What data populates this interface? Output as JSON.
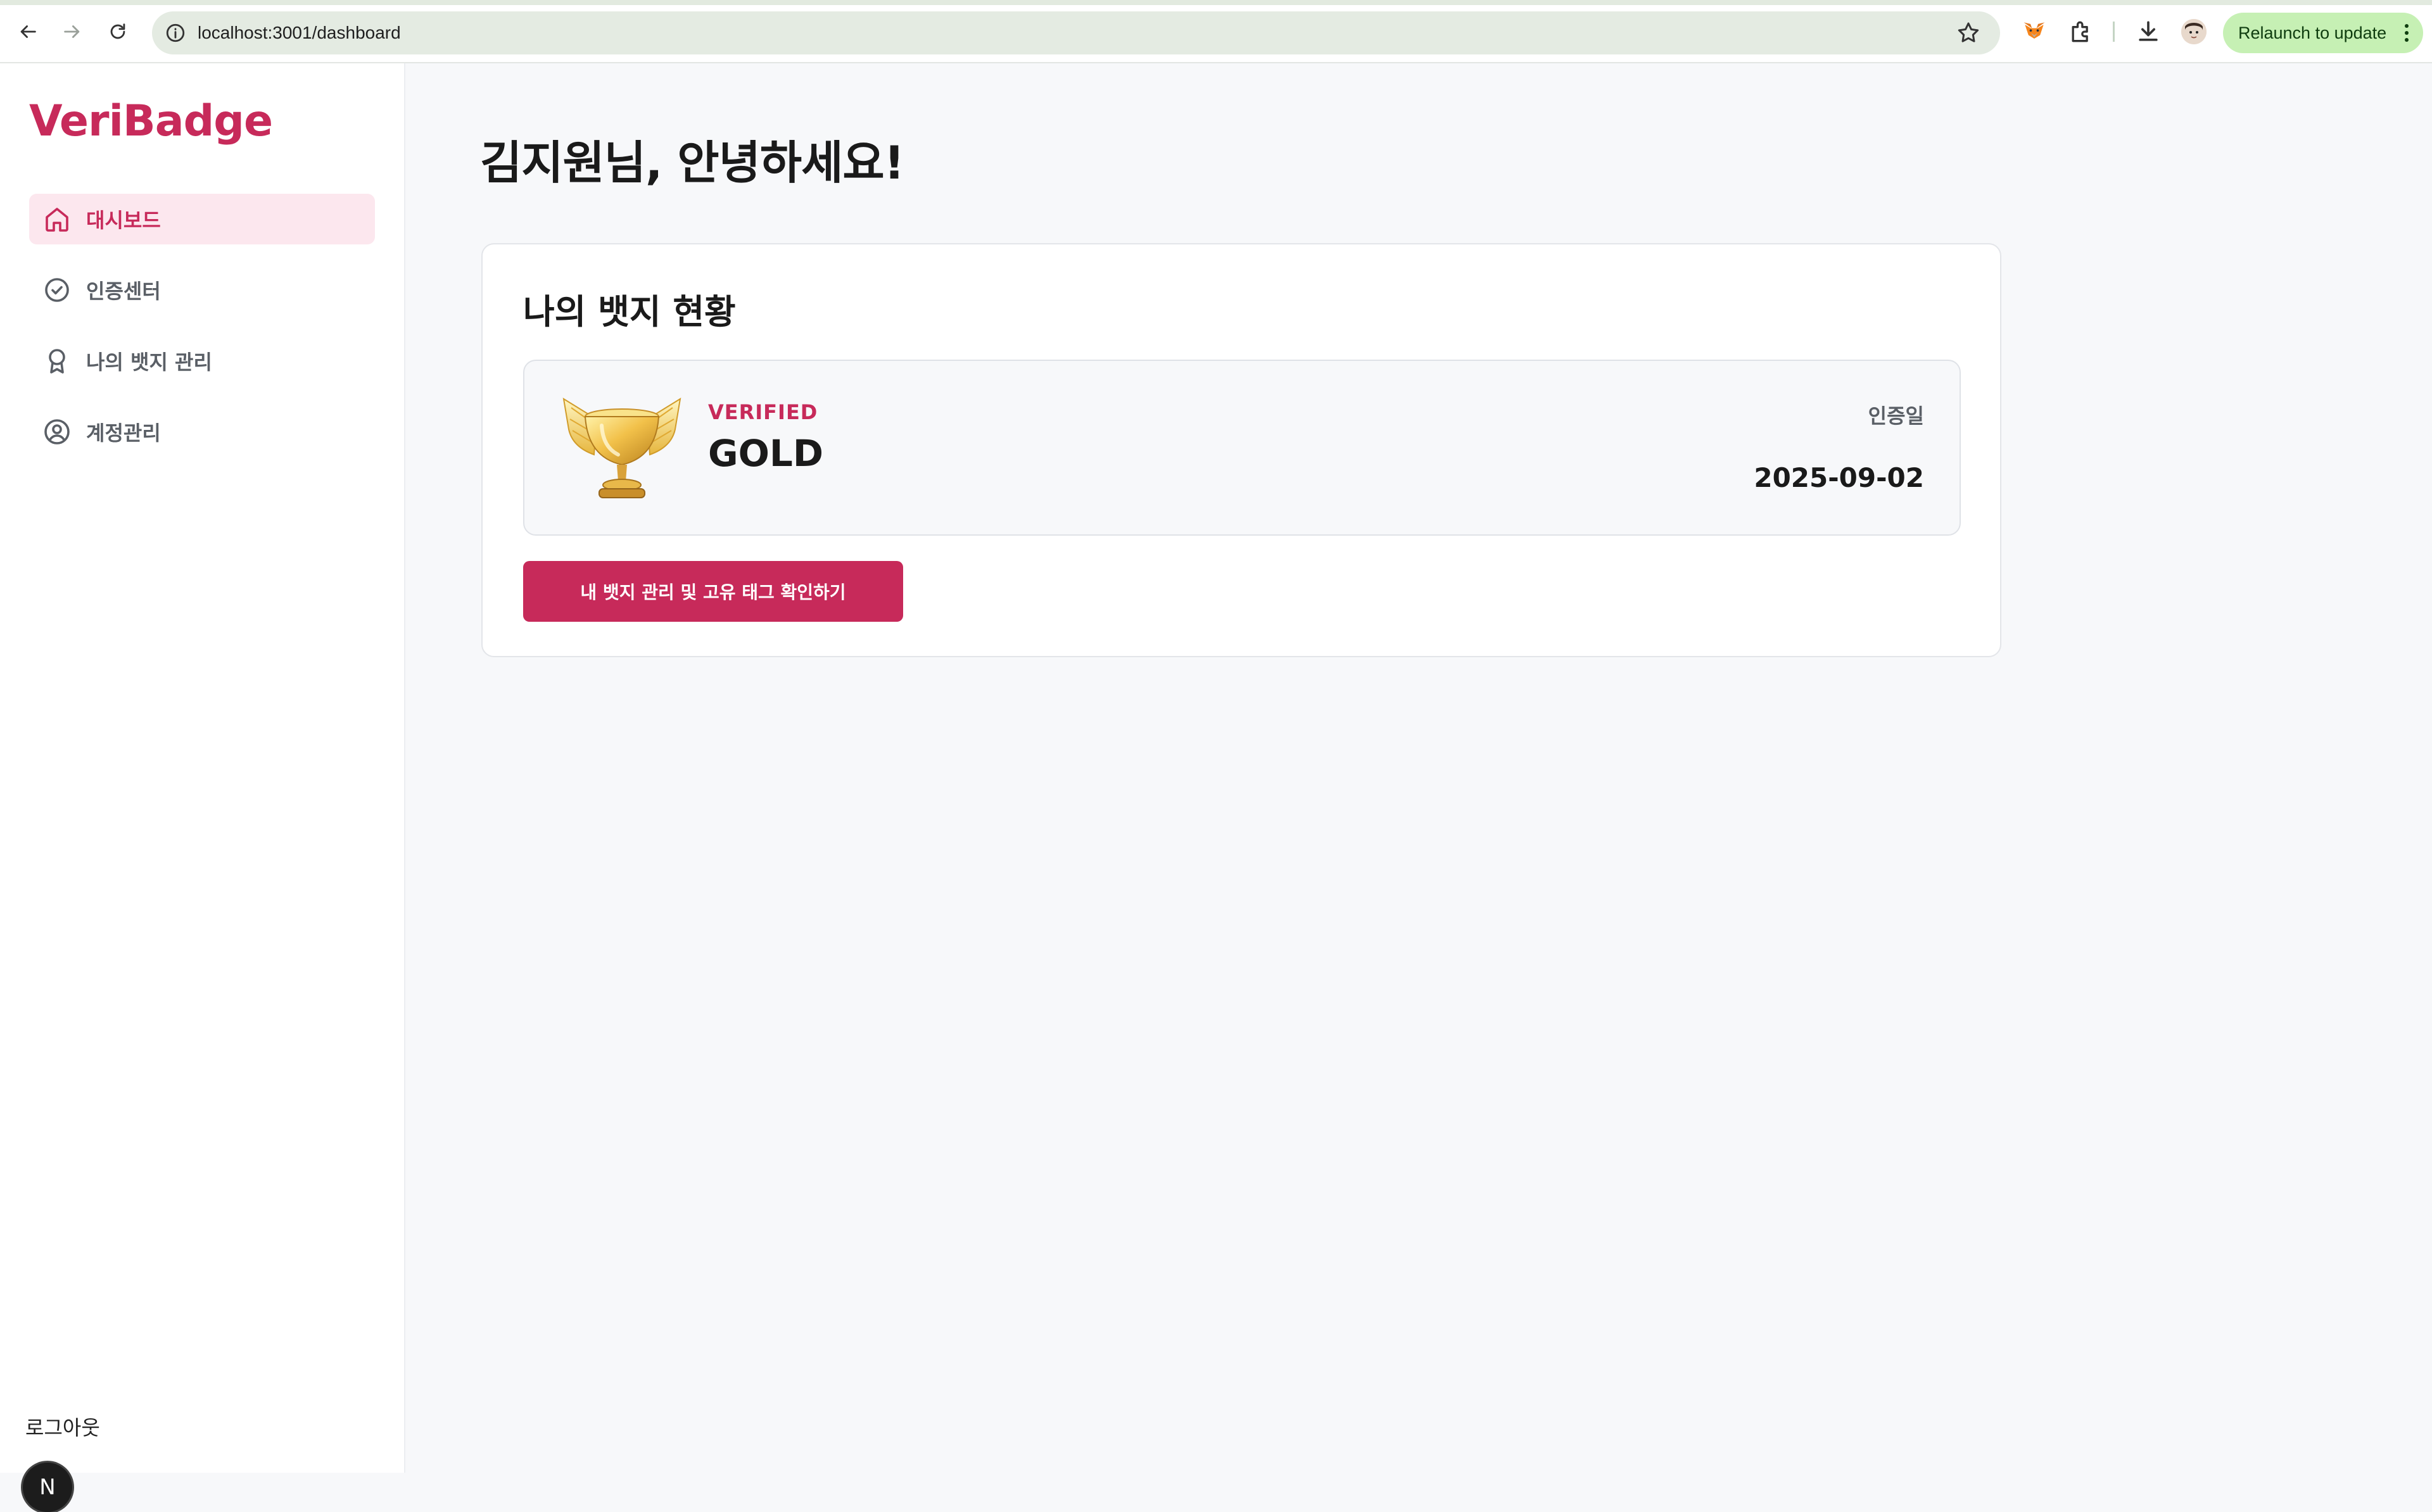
{
  "browser": {
    "url": "localhost:3001/dashboard",
    "relaunch_label": "Relaunch to update"
  },
  "sidebar": {
    "brand": "VeriBadge",
    "items": [
      {
        "label": "대시보드",
        "icon": "home-icon",
        "active": true
      },
      {
        "label": "인증센터",
        "icon": "check-circle-icon",
        "active": false
      },
      {
        "label": "나의 뱃지 관리",
        "icon": "award-icon",
        "active": false
      },
      {
        "label": "계정관리",
        "icon": "user-circle-icon",
        "active": false
      }
    ],
    "logout_label": "로그아웃"
  },
  "main": {
    "greeting": "김지원님, 안녕하세요!",
    "card": {
      "title": "나의 뱃지 현황",
      "badge": {
        "status": "VERIFIED",
        "tier": "GOLD",
        "icon": "trophy-icon",
        "date_label": "인증일",
        "date": "2025-09-02"
      },
      "cta_label": "내 뱃지 관리 및 고유 태그 확인하기"
    }
  },
  "overlay": {
    "next_badge_letter": "N"
  },
  "colors": {
    "accent": "#c72a5a",
    "active_bg": "#fce7ee",
    "page_bg": "#f7f8fa"
  }
}
